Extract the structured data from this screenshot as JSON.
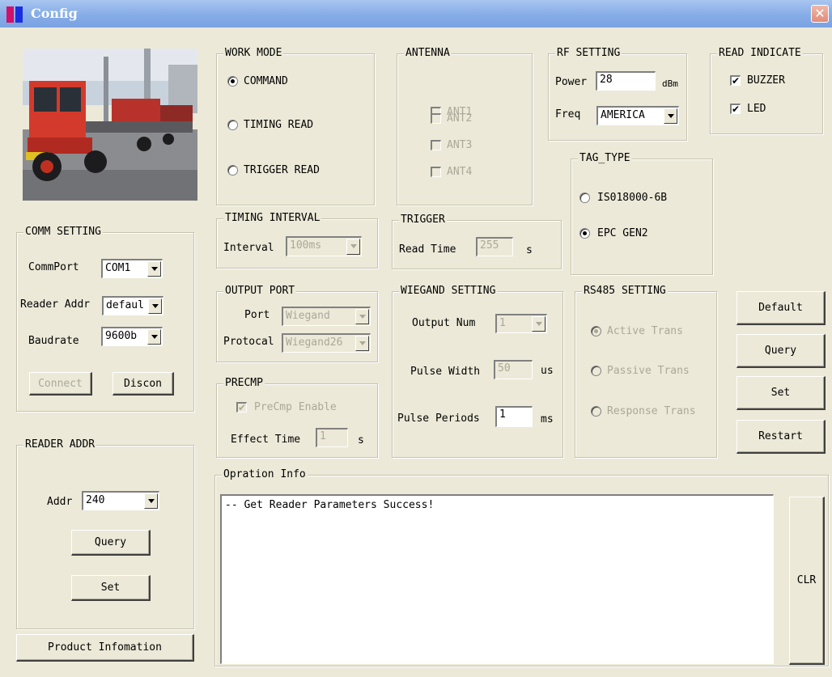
{
  "window": {
    "title": "Config",
    "close_glyph": "✕",
    "app_icon": "app-icon"
  },
  "photo": {
    "subject": "truck-photo"
  },
  "work_mode": {
    "legend": "WORK MODE",
    "options": [
      {
        "label": "COMMAND",
        "selected": true
      },
      {
        "label": "TIMING READ",
        "selected": false
      },
      {
        "label": "TRIGGER READ",
        "selected": false
      }
    ]
  },
  "antenna": {
    "legend": "ANTENNA",
    "items": [
      {
        "label": "ANT1",
        "checked": false,
        "enabled": false
      },
      {
        "label": "ANT2",
        "checked": false,
        "enabled": false
      },
      {
        "label": "ANT3",
        "checked": false,
        "enabled": false
      },
      {
        "label": "ANT4",
        "checked": false,
        "enabled": false
      }
    ]
  },
  "rf_setting": {
    "legend": "RF SETTING",
    "power_label": "Power",
    "power_value": "28",
    "power_unit": "dBm",
    "freq_label": "Freq",
    "freq_value": "AMERICA"
  },
  "read_indicate": {
    "legend": "READ INDICATE",
    "buzzer_label": "BUZZER",
    "buzzer_checked": true,
    "led_label": "LED",
    "led_checked": true
  },
  "tag_type": {
    "legend": "TAG_TYPE",
    "options": [
      {
        "label": "IS018000-6B",
        "selected": false
      },
      {
        "label": "EPC GEN2",
        "selected": true
      }
    ]
  },
  "comm_setting": {
    "legend": "COMM SETTING",
    "commport_label": "CommPort",
    "commport_value": "COM1",
    "reader_addr_label": "Reader Addr",
    "reader_addr_value": "defaul",
    "baudrate_label": "Baudrate",
    "baudrate_value": "9600b",
    "connect_label": "Connect",
    "discon_label": "Discon"
  },
  "timing_interval": {
    "legend": "TIMING INTERVAL",
    "interval_label": "Interval",
    "interval_value": "100ms"
  },
  "trigger": {
    "legend": "TRIGGER",
    "read_time_label": "Read Time",
    "read_time_value": "255",
    "unit": "s"
  },
  "output_port": {
    "legend": "OUTPUT PORT",
    "port_label": "Port",
    "port_value": "Wiegand",
    "protocol_label": "Protocal",
    "protocol_value": "Wiegand26"
  },
  "wiegand_setting": {
    "legend": "WIEGAND SETTING",
    "output_num_label": "Output Num",
    "output_num_value": "1",
    "pulse_width_label": "Pulse Width",
    "pulse_width_value": "50",
    "pulse_width_unit": "us",
    "pulse_periods_label": "Pulse Periods",
    "pulse_periods_value": "1",
    "pulse_periods_unit": "ms"
  },
  "rs485_setting": {
    "legend": "RS485 SETTING",
    "options": [
      {
        "label": "Active Trans",
        "selected": true
      },
      {
        "label": "Passive Trans",
        "selected": false
      },
      {
        "label": "Response Trans",
        "selected": false
      }
    ]
  },
  "precmp": {
    "legend": "PRECMP",
    "enable_label": "PreCmp Enable",
    "enable_checked": true,
    "effect_time_label": "Effect Time",
    "effect_time_value": "1",
    "effect_time_unit": "s"
  },
  "actions": {
    "default_label": "Default",
    "query_label": "Query",
    "set_label": "Set",
    "restart_label": "Restart"
  },
  "reader_addr": {
    "legend": "READER ADDR",
    "addr_label": "Addr",
    "addr_value": "240",
    "query_label": "Query",
    "set_label": "Set"
  },
  "product_info_label": "Product Infomation",
  "operation_info": {
    "legend": "Opration Info",
    "text": "-- Get Reader Parameters Success!",
    "clr_label": "CLR"
  }
}
